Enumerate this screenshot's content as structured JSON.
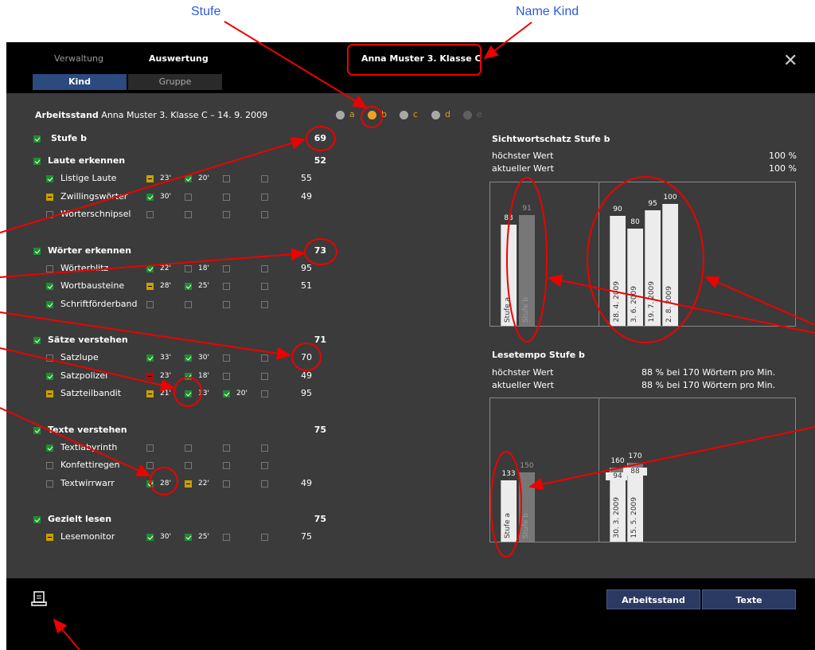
{
  "annotations": {
    "stufe": "Stufe",
    "name_kind": "Name Kind"
  },
  "nav": {
    "verwaltung": "Verwaltung",
    "auswertung": "Auswertung",
    "tab_kind": "Kind",
    "tab_gruppe": "Gruppe"
  },
  "header": {
    "child_class": "Anna Muster 3. Klasse C"
  },
  "status": {
    "prefix": "Arbeitsstand",
    "rest": "Anna Muster 3. Klasse C  –  14. 9. 2009"
  },
  "levels": [
    {
      "label": "a",
      "color": "#a8a8a8",
      "label_color": "#d4a020"
    },
    {
      "label": "b",
      "color": "#f0a020",
      "label_color": "#f0a020"
    },
    {
      "label": "c",
      "color": "#a8a8a8",
      "label_color": "#d4a020"
    },
    {
      "label": "d",
      "color": "#a8a8a8",
      "label_color": "#d4a020"
    },
    {
      "label": "e",
      "color": "#606060",
      "label_color": "#606060"
    }
  ],
  "left": {
    "stufe_label": "Stufe b",
    "stufe_value": "69",
    "groups": [
      {
        "title": "Laute erkennen",
        "value": "52",
        "items": [
          {
            "name": "Listige Laute",
            "c": [
              "y",
              "g",
              "",
              ""
            ],
            "t": [
              "23'",
              "20'",
              "",
              ""
            ],
            "v": "55"
          },
          {
            "name": "Zwillingswörter",
            "c": [
              "g",
              "",
              "",
              ""
            ],
            "t": [
              "30'",
              "",
              "",
              ""
            ],
            "v": "49"
          },
          {
            "name": "Wörterschnipsel",
            "c": [
              "",
              "",
              "",
              ""
            ],
            "t": [
              "",
              "",
              "",
              ""
            ],
            "v": ""
          }
        ]
      },
      {
        "title": "Wörter erkennen",
        "value": "73",
        "items": [
          {
            "name": "Wörterblitz",
            "c": [
              "g",
              "",
              "",
              ""
            ],
            "t": [
              "22'",
              "18'",
              "",
              ""
            ],
            "v": "95"
          },
          {
            "name": "Wortbausteine",
            "c": [
              "y",
              "g",
              "",
              ""
            ],
            "t": [
              "28'",
              "25'",
              "",
              ""
            ],
            "v": "51"
          },
          {
            "name": "Schriftförderband",
            "c": [
              "",
              "",
              "",
              ""
            ],
            "t": [
              "",
              "",
              "",
              ""
            ],
            "v": ""
          }
        ]
      },
      {
        "title": "Sätze verstehen",
        "value": "71",
        "items": [
          {
            "name": "Satzlupe",
            "c": [
              "g",
              "g",
              "",
              ""
            ],
            "t": [
              "33'",
              "30'",
              "",
              ""
            ],
            "v": "70"
          },
          {
            "name": "Satzpolizei",
            "c": [
              "r",
              "g",
              "",
              ""
            ],
            "t": [
              "23'",
              "18'",
              "",
              ""
            ],
            "v": "49"
          },
          {
            "name": "Satzteilbandit",
            "c": [
              "y",
              "g",
              "g",
              ""
            ],
            "t": [
              "21'",
              "13'",
              "20'",
              ""
            ],
            "v": "95"
          }
        ]
      },
      {
        "title": "Texte verstehen",
        "value": "75",
        "items": [
          {
            "name": "Textlabyrinth",
            "c": [
              "",
              "",
              "",
              ""
            ],
            "t": [
              "",
              "",
              "",
              ""
            ],
            "v": ""
          },
          {
            "name": "Konfettiregen",
            "c": [
              "",
              "",
              "",
              ""
            ],
            "t": [
              "",
              "",
              "",
              ""
            ],
            "v": ""
          },
          {
            "name": "Textwirrwarr",
            "c": [
              "g",
              "y",
              "",
              ""
            ],
            "t": [
              "28'",
              "22'",
              "",
              ""
            ],
            "v": "49"
          }
        ]
      },
      {
        "title": "Gezielt lesen",
        "value": "75",
        "items": [
          {
            "name": "Lesemonitor",
            "c": [
              "g",
              "g",
              "",
              ""
            ],
            "t": [
              "30'",
              "25'",
              "",
              ""
            ],
            "v": "75"
          }
        ]
      }
    ]
  },
  "sicht": {
    "title": "Sichtwortschatz Stufe b",
    "max_label": "höchster Wert",
    "max_val": "100 %",
    "cur_label": "aktueller Wert",
    "cur_val": "100 %"
  },
  "lese": {
    "title": "Lesetempo Stufe b",
    "max_label": "höchster Wert",
    "max_val": "88 %  bei  170 Wörtern pro Min.",
    "cur_label": "aktueller Wert",
    "cur_val": "88 %  bei  170 Wörtern pro Min."
  },
  "chart_data": [
    {
      "type": "bar",
      "title": "Sichtwortschatz Stufe b",
      "ylim": [
        0,
        100
      ],
      "categories": [
        "Stufe a",
        "Stufe b",
        "28. 4. 2009",
        "3. 6. 2009",
        "19. 7. 2009",
        "2. 8. 2009"
      ],
      "values": [
        83,
        91,
        90,
        80,
        95,
        100
      ]
    },
    {
      "type": "bar",
      "title": "Lesetempo Stufe b",
      "categories": [
        "Stufe a",
        "Stufe b",
        "30. 3. 2009",
        "15. 5. 2009"
      ],
      "values": [
        133,
        150,
        160,
        170
      ],
      "secondary_values": [
        null,
        null,
        94,
        88
      ]
    }
  ],
  "buttons": {
    "arbeitsstand": "Arbeitsstand",
    "texte": "Texte"
  },
  "colors": {
    "accent_blue": "#2a5bd7",
    "annotation_red": "#e00000",
    "button_bg": "#2b3a63",
    "tab_active": "#2b4a80"
  }
}
